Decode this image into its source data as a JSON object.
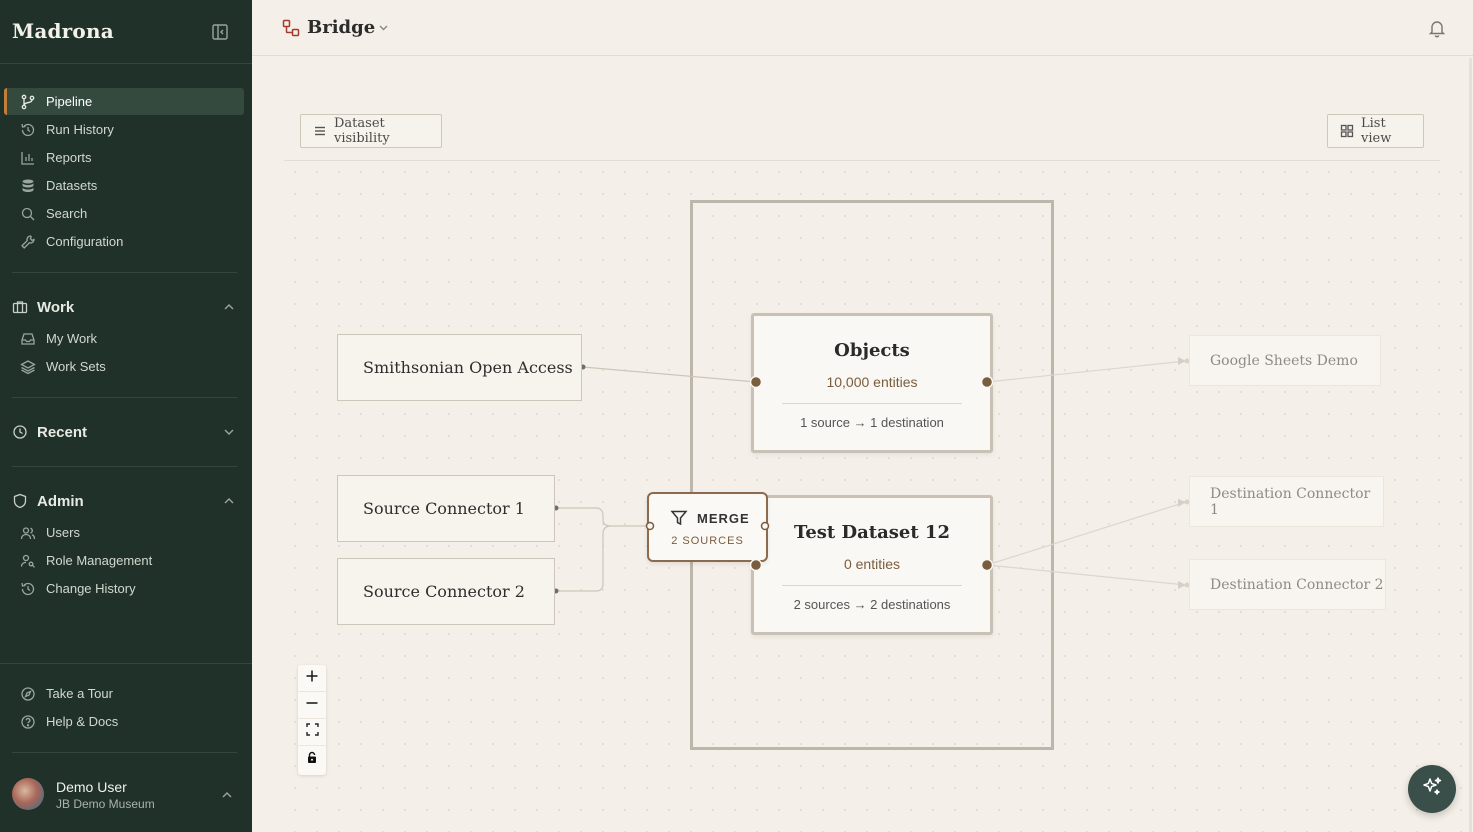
{
  "app": {
    "brand": "Madrona"
  },
  "sidebar": {
    "nav": [
      {
        "label": "Pipeline",
        "icon": "pipeline-icon",
        "active": true
      },
      {
        "label": "Run History",
        "icon": "history-icon"
      },
      {
        "label": "Reports",
        "icon": "chart-icon"
      },
      {
        "label": "Datasets",
        "icon": "database-icon"
      },
      {
        "label": "Search",
        "icon": "search-icon"
      },
      {
        "label": "Configuration",
        "icon": "wrench-icon"
      }
    ],
    "work": {
      "title": "Work",
      "items": [
        {
          "label": "My Work",
          "icon": "inbox-icon"
        },
        {
          "label": "Work Sets",
          "icon": "layers-icon"
        }
      ]
    },
    "recent": {
      "title": "Recent"
    },
    "admin": {
      "title": "Admin",
      "items": [
        {
          "label": "Users",
          "icon": "users-icon"
        },
        {
          "label": "Role Management",
          "icon": "user-key-icon"
        },
        {
          "label": "Change History",
          "icon": "history-icon"
        }
      ]
    },
    "footer": [
      {
        "label": "Take a Tour",
        "icon": "compass-icon"
      },
      {
        "label": "Help & Docs",
        "icon": "help-icon"
      }
    ],
    "user": {
      "name": "Demo User",
      "org": "JB Demo Museum"
    }
  },
  "topbar": {
    "project": "Bridge"
  },
  "toolbar": {
    "dataset_visibility": "Dataset visibility",
    "list_view": "List view"
  },
  "graph": {
    "sources": [
      "Smithsonian Open Access",
      "Source Connector 1",
      "Source Connector 2"
    ],
    "datasets": [
      {
        "title": "Objects",
        "count": "10,000 entities",
        "flow": "1 source → 1 destination"
      },
      {
        "title": "Test Dataset 12",
        "count": "0 entities",
        "flow": "2 sources → 2 destinations"
      }
    ],
    "merge": {
      "label": "MERGE",
      "sub": "2 SOURCES"
    },
    "destinations": [
      "Google Sheets Demo",
      "Destination Connector 1",
      "Destination Connector 2"
    ]
  },
  "colors": {
    "sidebar_bg": "#1f3128",
    "accent": "#c47e3a",
    "canvas_bg": "#f4efe8",
    "node_handle": "#7a5c3e"
  }
}
